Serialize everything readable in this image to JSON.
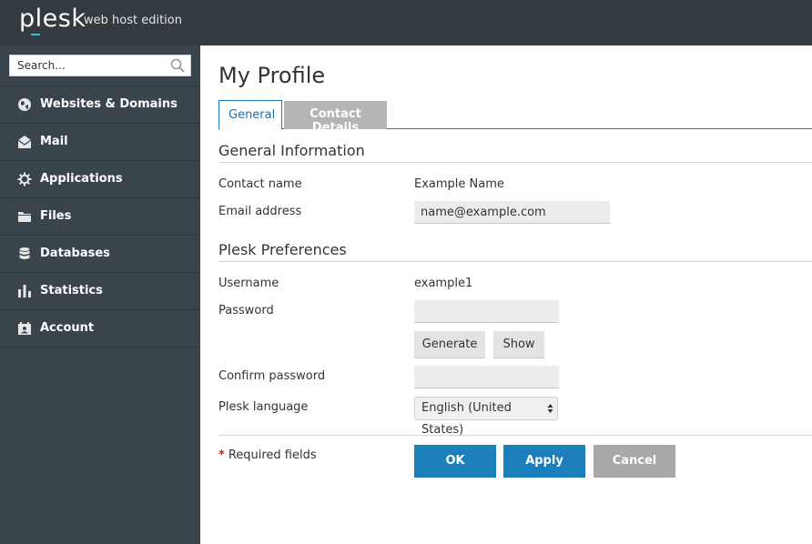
{
  "header": {
    "logo": "plesk",
    "edition": "web host edition"
  },
  "sidebar": {
    "search": {
      "placeholder": "Search..."
    },
    "items": [
      {
        "label": "Websites & Domains",
        "icon": "globe-icon"
      },
      {
        "label": "Mail",
        "icon": "mail-icon"
      },
      {
        "label": "Applications",
        "icon": "gear-icon"
      },
      {
        "label": "Files",
        "icon": "folder-icon"
      },
      {
        "label": "Databases",
        "icon": "database-icon"
      },
      {
        "label": "Statistics",
        "icon": "bar-chart-icon"
      },
      {
        "label": "Account",
        "icon": "account-icon"
      }
    ]
  },
  "main": {
    "title": "My Profile",
    "tabs": [
      {
        "label": "General",
        "active": true
      },
      {
        "label": "Contact Details",
        "active": false
      }
    ],
    "general_info": {
      "title": "General Information",
      "contact_name_label": "Contact name",
      "contact_name_value": "Example Name",
      "email_label": "Email address",
      "email_value": "name@example.com"
    },
    "preferences": {
      "title": "Plesk Preferences",
      "username_label": "Username",
      "username_value": "example1",
      "password_label": "Password",
      "password_value": "",
      "generate_label": "Generate",
      "show_label": "Show",
      "confirm_label": "Confirm password",
      "confirm_value": "",
      "language_label": "Plesk language",
      "language_value": "English (United States)"
    },
    "footer": {
      "required_star": "*",
      "required_text": "Required fields",
      "ok_label": "OK",
      "apply_label": "Apply",
      "cancel_label": "Cancel"
    }
  },
  "colors": {
    "header_bg": "#333a40",
    "sidebar_bg": "#3a444b",
    "accent": "#1b7fbb",
    "tab_inactive": "#b5b5b5",
    "cancel": "#a8a8a8",
    "required_star": "#d02020"
  }
}
